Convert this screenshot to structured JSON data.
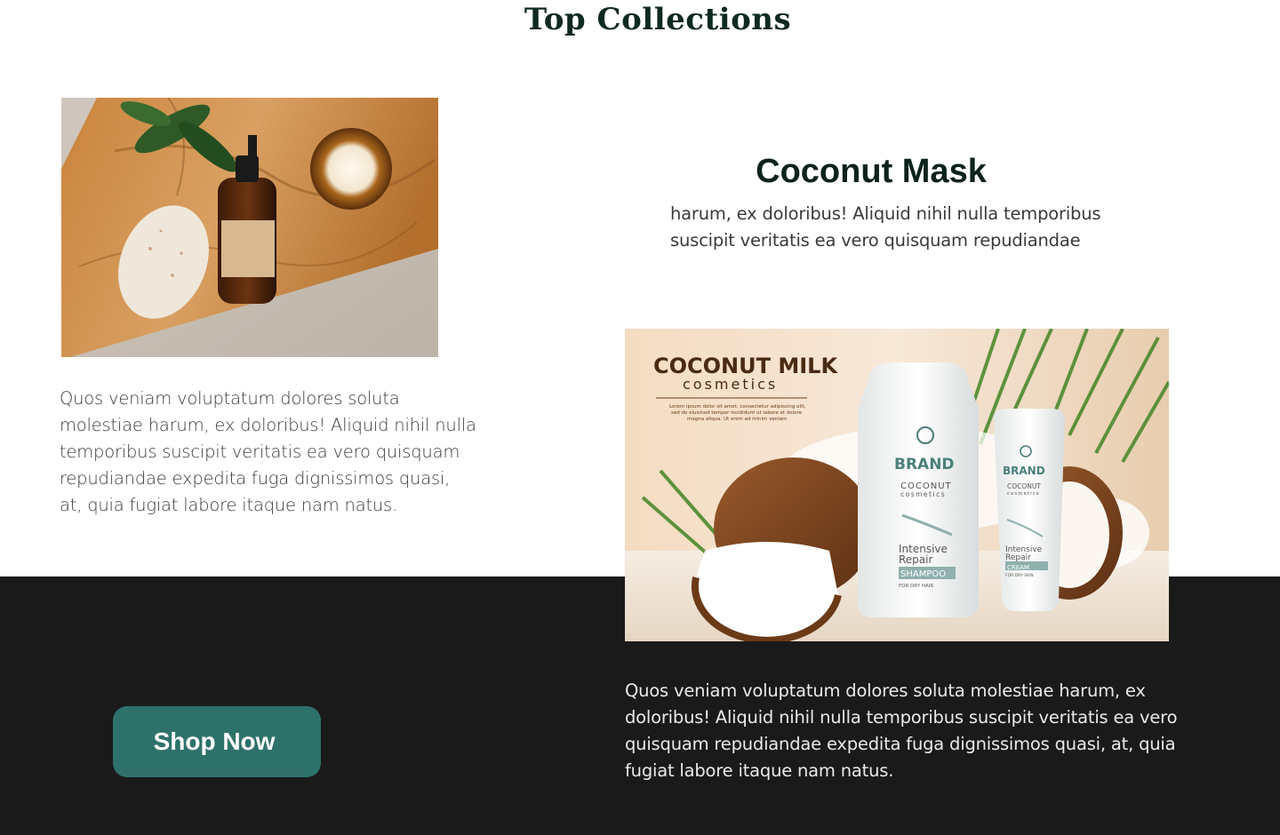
{
  "section": {
    "title": "Top Collections"
  },
  "collection_1": {
    "image_alt": "spa-products-on-wooden-board",
    "description": "Quos veniam voluptatum dolores soluta molestiae harum, ex doloribus! Aliquid nihil nulla temporibus suscipit veritatis ea vero quisquam repudiandae expedita fuga dignissimos quasi, at, quia fugiat labore itaque nam natus."
  },
  "collection_2": {
    "title": "Coconut Mask",
    "subtitle": "harum, ex doloribus! Aliquid nihil nulla temporibus suscipit veritatis ea vero quisquam repudiandae",
    "image_alt": "coconut-milk-cosmetics-ad",
    "ad": {
      "headline": "COCONUT MILK",
      "subline": "cosmetics",
      "blurb_1": "Lorem ipsum dolor sit amet, consectetur adipiscing elit,",
      "blurb_2": "sed do eiusmod tempor incididunt ut labore et dolore",
      "blurb_3": "magna aliqua. Ut enim ad minim veniam",
      "bottle_brand": "BRAND",
      "bottle_line_1": "COCONUT",
      "bottle_line_2": "cosmetics",
      "bottle_product_1": "Intensive",
      "bottle_product_2": "Repair",
      "bottle_type": "SHAMPOO",
      "bottle_note": "FOR DRY HAIR",
      "tube_brand": "BRAND",
      "tube_line_1": "COCONUT",
      "tube_line_2": "cosmetics",
      "tube_product_1": "Intensive",
      "tube_product_2": "Repair",
      "tube_type": "CREAM",
      "tube_note": "FOR DRY SKIN"
    },
    "description": "Quos veniam voluptatum dolores soluta molestiae harum, ex doloribus! Aliquid nihil nulla temporibus suscipit veritatis ea vero quisquam repudiandae expedita fuga dignissimos quasi, at, quia fugiat labore itaque nam natus."
  },
  "cta": {
    "label": "Shop Now"
  },
  "colors": {
    "accent": "#2e716b",
    "dark_band": "#1a1a1a",
    "heading": "#0f2a20"
  }
}
